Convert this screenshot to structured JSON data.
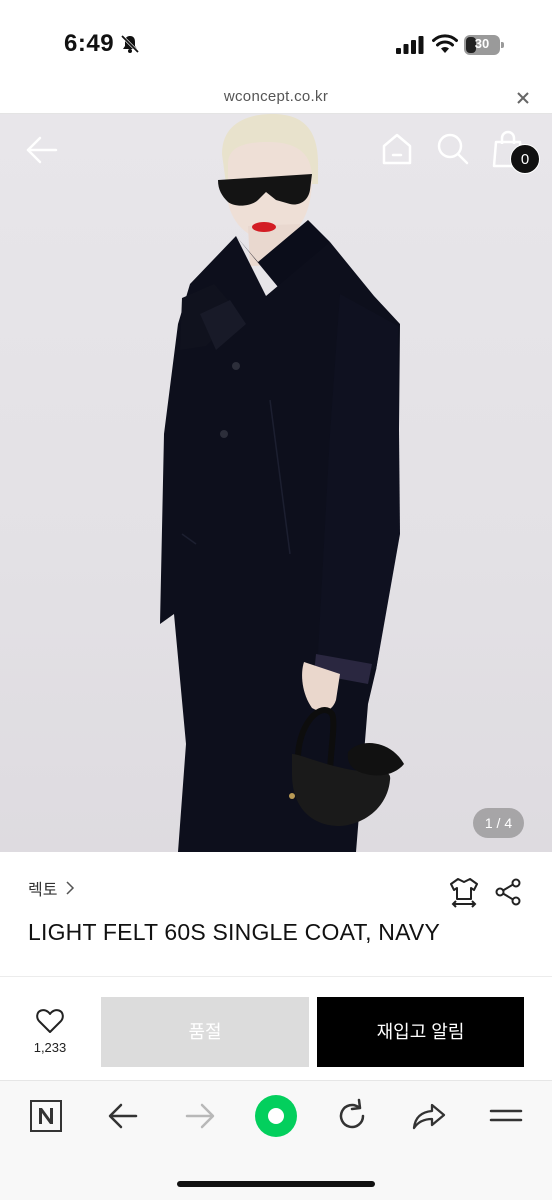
{
  "status_bar": {
    "time": "6:49",
    "battery": "30",
    "battery_level": 0.3
  },
  "url_bar": {
    "domain": "wconcept.co.kr"
  },
  "hero": {
    "cart_count": "0",
    "page_indicator": "1 / 4"
  },
  "product": {
    "brand": "렉토",
    "title": "LIGHT FELT 60S SINGLE COAT, NAVY"
  },
  "purchase_bar": {
    "wish_count": "1,233",
    "soldout_label": "품절",
    "restock_label": "재입고 알림"
  },
  "toolbar": {
    "accent_color": "#03cf5d",
    "icons": [
      "naver-icon",
      "back-arrow-icon",
      "forward-arrow-icon",
      "green-dot-icon",
      "refresh-icon",
      "share-arrow-icon",
      "menu-icon"
    ]
  },
  "colors": {
    "soldout_bg": "#dcdcdc",
    "restock_bg": "#000000",
    "lips": "#d31d24"
  }
}
